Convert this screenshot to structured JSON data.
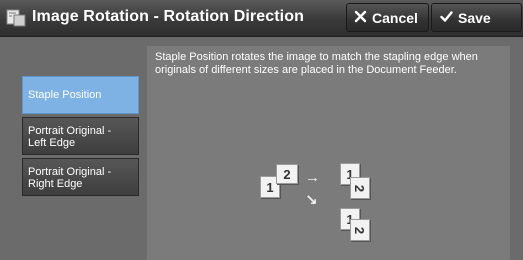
{
  "header": {
    "title": "Image Rotation - Rotation Direction",
    "app_icon": "image-rotation-icon",
    "cancel_label": "Cancel",
    "cancel_icon": "x-icon",
    "save_label": "Save",
    "save_icon": "checkmark-icon"
  },
  "sidebar": {
    "items": [
      {
        "label": "Staple Position",
        "selected": true
      },
      {
        "label": "Portrait Original - Left Edge",
        "selected": false
      },
      {
        "label": "Portrait Original - Right Edge",
        "selected": false
      }
    ]
  },
  "main": {
    "description": "Staple Position rotates the image to match the stapling edge when originals of different sizes are placed in the Document Feeder.",
    "diagram": {
      "page_1": "1",
      "page_2": "2"
    }
  }
}
